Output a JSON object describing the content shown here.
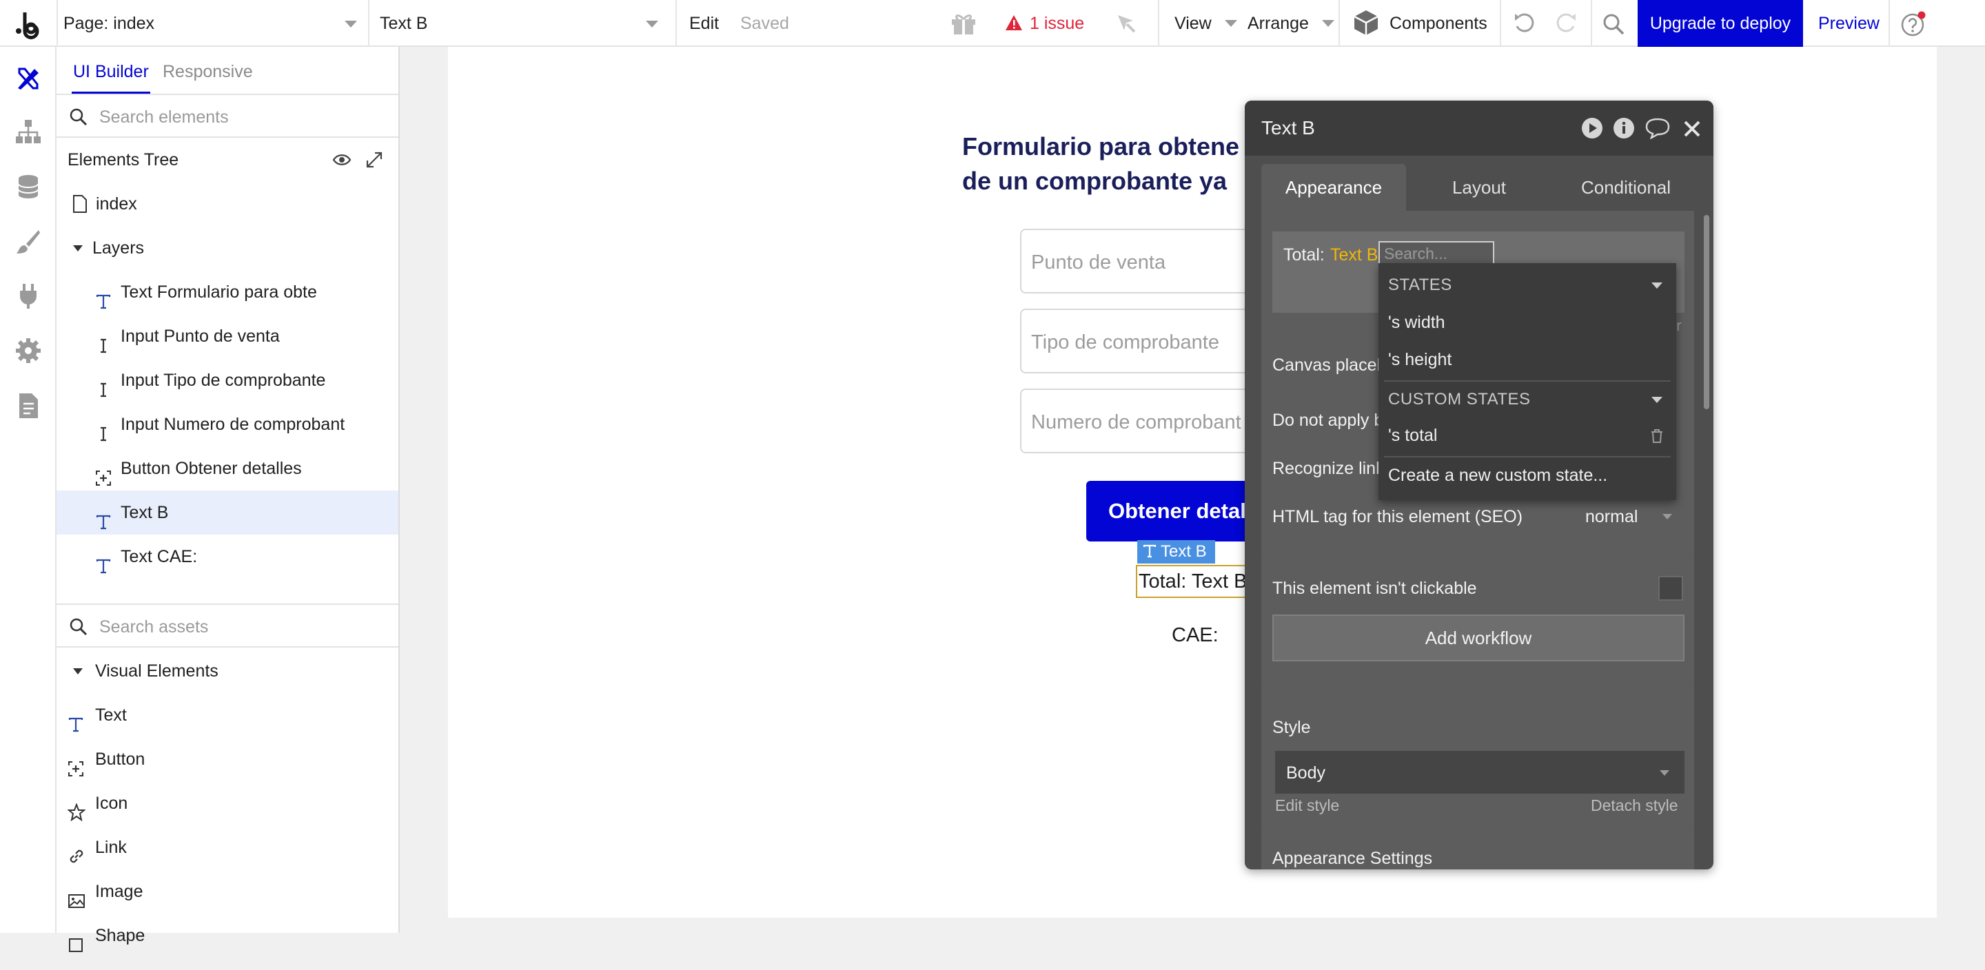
{
  "topbar": {
    "page_label": "Page: index",
    "element_label": "Text B",
    "edit": "Edit",
    "saved": "Saved",
    "issues": "1 issue",
    "view": "View",
    "arrange": "Arrange",
    "components": "Components",
    "deploy": "Upgrade to deploy",
    "preview": "Preview",
    "colors": {
      "deploy_bg": "#0205d3",
      "issue": "#e0243a",
      "preview": "#0205d3"
    }
  },
  "rail": {
    "icons": [
      "design-icon",
      "workflow-icon",
      "data-icon",
      "styles-icon",
      "plugins-icon",
      "settings-icon",
      "logs-icon"
    ]
  },
  "left_panel": {
    "tabs": [
      "UI Builder",
      "Responsive"
    ],
    "search_elements_placeholder": "Search elements",
    "tree_title": "Elements Tree",
    "page_item": "index",
    "layers_label": "Layers",
    "layers": [
      {
        "icon": "text-icon",
        "label": "Text Formulario para obte",
        "selected": false
      },
      {
        "icon": "input-icon",
        "label": "Input Punto de venta",
        "selected": false
      },
      {
        "icon": "input-icon",
        "label": "Input Tipo de comprobante",
        "selected": false
      },
      {
        "icon": "input-icon",
        "label": "Input Numero de comprobant",
        "selected": false
      },
      {
        "icon": "button-icon",
        "label": "Button Obtener detalles",
        "selected": false
      },
      {
        "icon": "text-icon",
        "label": "Text B",
        "selected": true
      },
      {
        "icon": "text-icon",
        "label": "Text CAE:",
        "selected": false
      }
    ],
    "search_assets_placeholder": "Search assets",
    "visual_elements_label": "Visual Elements",
    "visual_elements": [
      {
        "icon": "text-icon",
        "label": "Text"
      },
      {
        "icon": "button-icon",
        "label": "Button"
      },
      {
        "icon": "star-icon",
        "label": "Icon"
      },
      {
        "icon": "link-icon",
        "label": "Link"
      },
      {
        "icon": "image-icon",
        "label": "Image"
      },
      {
        "icon": "shape-icon",
        "label": "Shape"
      }
    ]
  },
  "canvas": {
    "heading_line1": "Formulario para obtene",
    "heading_line2": "de un comprobante ya",
    "inputs": [
      "Punto de venta",
      "Tipo de comprobante",
      "Numero de comprobant"
    ],
    "button_label": "Obtener detal",
    "selected_tag": "Text B",
    "total_text": "Total: Text B",
    "cae_text": "CAE:",
    "colors": {
      "button_bg": "#0205d3",
      "heading": "#1a1e5a",
      "tag_bg": "#4a90e2"
    }
  },
  "property_editor": {
    "title": "Text B",
    "tabs": [
      "Appearance",
      "Layout",
      "Conditional"
    ],
    "active_tab": "Appearance",
    "expression_prefix": "Total:",
    "expression_ref": "Text B",
    "search_placeholder": "Search...",
    "peek_or": "or",
    "canvas_placeholder": "Canvas placeh",
    "do_not_apply": "Do not apply b",
    "recognize_links": "Recognize link",
    "html_tag_label": "HTML tag for this element (SEO)",
    "html_tag_value": "normal",
    "not_clickable": "This element isn't clickable",
    "add_workflow": "Add workflow",
    "style_label": "Style",
    "style_value": "Body",
    "edit_style": "Edit style",
    "detach_style": "Detach style",
    "appearance_settings": "Appearance Settings"
  },
  "dropdown": {
    "states_header": "STATES",
    "states": [
      "'s width",
      "'s height"
    ],
    "custom_header": "CUSTOM STATES",
    "custom_states": [
      "'s total"
    ],
    "create_label": "Create a new custom state..."
  }
}
